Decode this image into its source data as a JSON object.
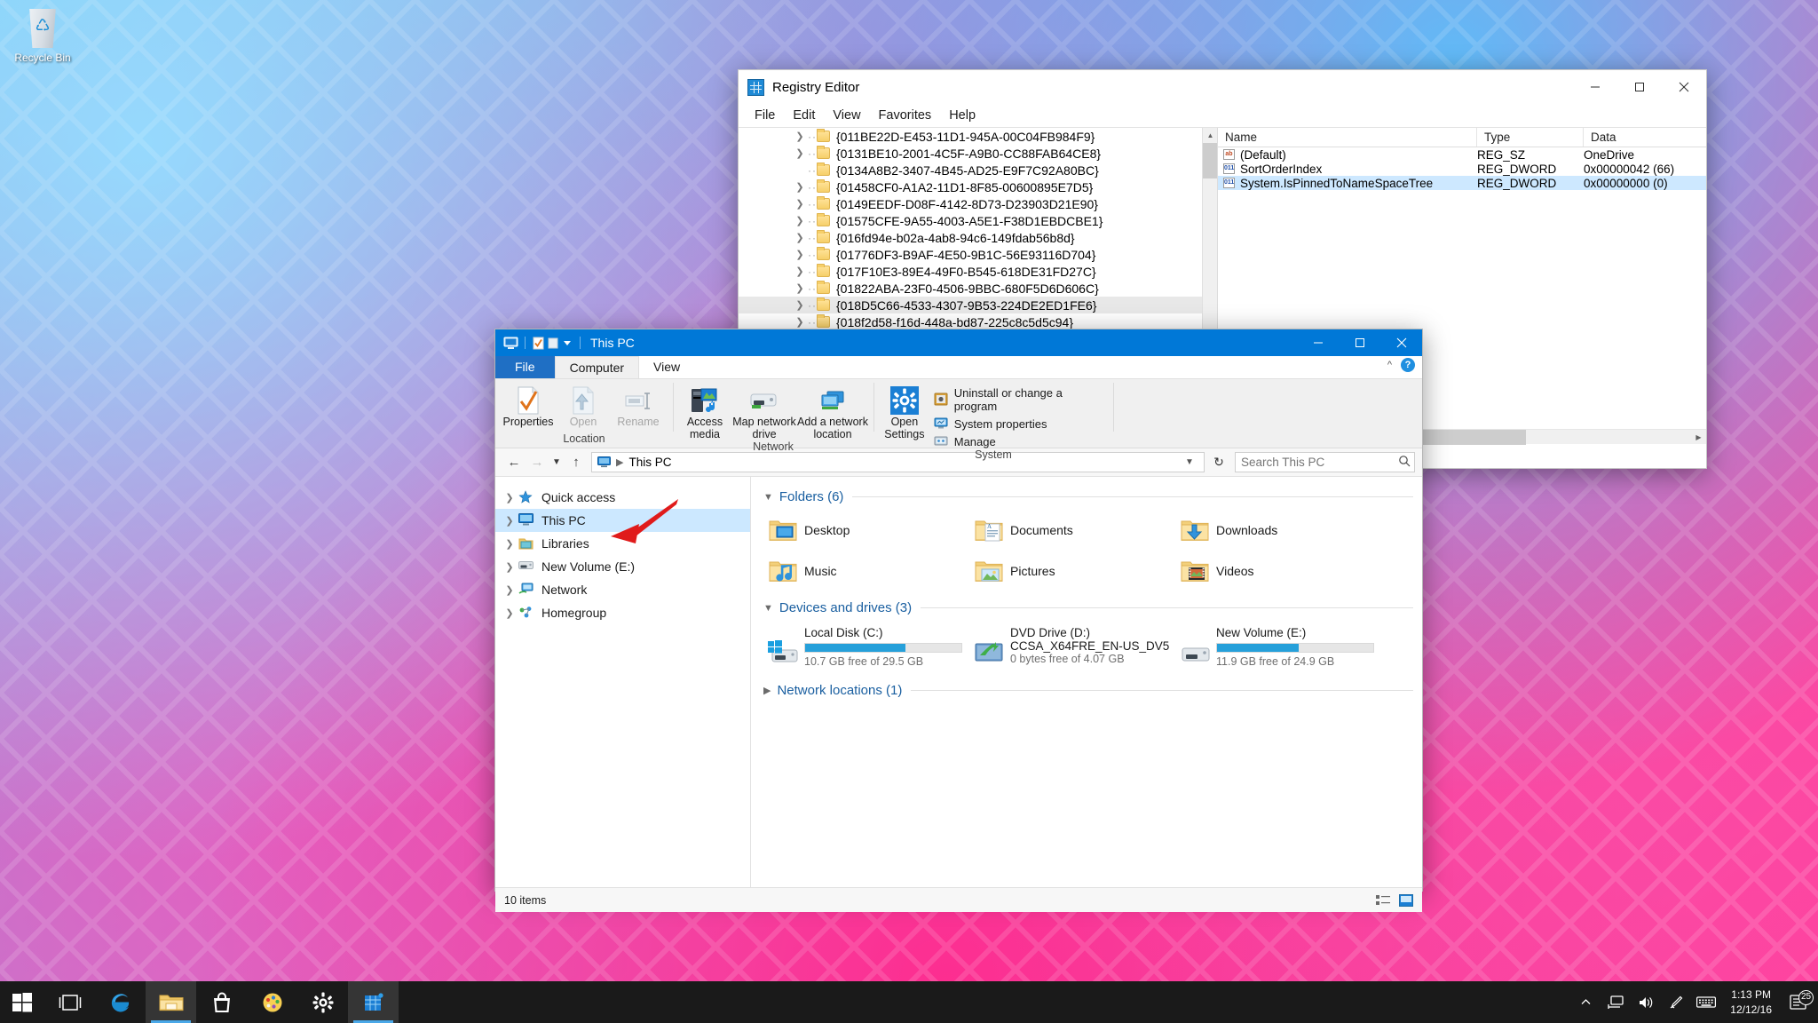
{
  "desktop": {
    "recycle_bin_label": "Recycle Bin"
  },
  "regedit": {
    "title": "Registry Editor",
    "menus": [
      "File",
      "Edit",
      "View",
      "Favorites",
      "Help"
    ],
    "window_buttons": [
      "minimize",
      "maximize",
      "close"
    ],
    "tree_items": [
      {
        "label": "{011BE22D-E453-11D1-945A-00C04FB984F9}",
        "expandable": true,
        "selected": false
      },
      {
        "label": "{0131BE10-2001-4C5F-A9B0-CC88FAB64CE8}",
        "expandable": true,
        "selected": false
      },
      {
        "label": "{0134A8B2-3407-4B45-AD25-E9F7C92A80BC}",
        "expandable": false,
        "selected": false
      },
      {
        "label": "{01458CF0-A1A2-11D1-8F85-00600895E7D5}",
        "expandable": true,
        "selected": false
      },
      {
        "label": "{0149EEDF-D08F-4142-8D73-D23903D21E90}",
        "expandable": true,
        "selected": false
      },
      {
        "label": "{01575CFE-9A55-4003-A5E1-F38D1EBDCBE1}",
        "expandable": true,
        "selected": false
      },
      {
        "label": "{016fd94e-b02a-4ab8-94c6-149fdab56b8d}",
        "expandable": true,
        "selected": false
      },
      {
        "label": "{01776DF3-B9AF-4E50-9B1C-56E93116D704}",
        "expandable": true,
        "selected": false
      },
      {
        "label": "{017F10E3-89E4-49F0-B545-618DE31FD27C}",
        "expandable": true,
        "selected": false
      },
      {
        "label": "{01822ABA-23F0-4506-9BBC-680F5D6D606C}",
        "expandable": true,
        "selected": false
      },
      {
        "label": "{018D5C66-4533-4307-9B53-224DE2ED1FE6}",
        "expandable": true,
        "selected": true
      },
      {
        "label": "{018f2d58-f16d-448a-bd87-225c8c5d5c94}",
        "expandable": true,
        "selected": false
      }
    ],
    "value_columns": [
      "Name",
      "Type",
      "Data"
    ],
    "values": [
      {
        "icon": "string-value-icon",
        "name": "(Default)",
        "type": "REG_SZ",
        "data": "OneDrive",
        "selected": false
      },
      {
        "icon": "dword-value-icon",
        "name": "SortOrderIndex",
        "type": "REG_DWORD",
        "data": "0x00000042 (66)",
        "selected": false
      },
      {
        "icon": "dword-value-icon",
        "name": "System.IsPinnedToNameSpaceTree",
        "type": "REG_DWORD",
        "data": "0x00000000 (0)",
        "selected": true
      }
    ]
  },
  "explorer": {
    "title": "This PC",
    "quick_access_toolbar": [
      "this-pc-icon",
      "properties-icon",
      "new-folder-icon",
      "customize-dropdown"
    ],
    "window_buttons": [
      "minimize",
      "maximize",
      "close"
    ],
    "ribbon_tabs": [
      {
        "label": "File",
        "state": "file"
      },
      {
        "label": "Computer",
        "state": "active"
      },
      {
        "label": "View",
        "state": "normal"
      }
    ],
    "ribbon_right": [
      "collapse-ribbon-chevron",
      "help-button"
    ],
    "ribbon_groups": [
      {
        "label": "Location",
        "buttons": [
          {
            "label": "Properties",
            "icon": "properties-icon",
            "disabled": false,
            "dropdown": false
          },
          {
            "label": "Open",
            "icon": "open-icon",
            "disabled": true,
            "dropdown": false
          },
          {
            "label": "Rename",
            "icon": "rename-icon",
            "disabled": true,
            "dropdown": false
          }
        ]
      },
      {
        "label": "Network",
        "buttons": [
          {
            "label": "Access media",
            "icon": "access-media-icon",
            "disabled": false,
            "dropdown": true
          },
          {
            "label": "Map network drive",
            "icon": "map-network-drive-icon",
            "disabled": false,
            "dropdown": true
          },
          {
            "label": "Add a network location",
            "icon": "add-network-location-icon",
            "disabled": false,
            "dropdown": false
          }
        ]
      },
      {
        "label": "System",
        "buttons": [
          {
            "label": "Open Settings",
            "icon": "open-settings-icon",
            "disabled": false,
            "dropdown": false
          }
        ],
        "small_commands": [
          {
            "label": "Uninstall or change a program",
            "icon": "uninstall-program-icon"
          },
          {
            "label": "System properties",
            "icon": "system-properties-icon"
          },
          {
            "label": "Manage",
            "icon": "manage-icon"
          }
        ]
      }
    ],
    "address_bar": {
      "back": "back-arrow",
      "forward": "forward-arrow",
      "recent": "recent-locations-chevron",
      "up": "up-arrow",
      "breadcrumb": [
        "This PC"
      ],
      "refresh": "refresh-icon"
    },
    "search": {
      "placeholder": "Search This PC",
      "value": ""
    },
    "nav_pane": [
      {
        "label": "Quick access",
        "icon": "star-icon",
        "selected": false
      },
      {
        "label": "This PC",
        "icon": "this-pc-icon",
        "selected": true
      },
      {
        "label": "Libraries",
        "icon": "libraries-icon",
        "selected": false
      },
      {
        "label": "New Volume (E:)",
        "icon": "drive-icon",
        "selected": false
      },
      {
        "label": "Network",
        "icon": "network-icon",
        "selected": false
      },
      {
        "label": "Homegroup",
        "icon": "homegroup-icon",
        "selected": false
      }
    ],
    "sections": {
      "folders": {
        "title": "Folders (6)",
        "expanded": true,
        "items": [
          {
            "label": "Desktop",
            "icon": "desktop-folder-icon"
          },
          {
            "label": "Documents",
            "icon": "documents-folder-icon"
          },
          {
            "label": "Downloads",
            "icon": "downloads-folder-icon"
          },
          {
            "label": "Music",
            "icon": "music-folder-icon"
          },
          {
            "label": "Pictures",
            "icon": "pictures-folder-icon"
          },
          {
            "label": "Videos",
            "icon": "videos-folder-icon"
          }
        ]
      },
      "devices": {
        "title": "Devices and drives (3)",
        "expanded": true,
        "items": [
          {
            "name": "Local Disk (C:)",
            "free": "10.7 GB free of 29.5 GB",
            "used_percent": 64,
            "icon": "windows-drive-icon",
            "subtitle": ""
          },
          {
            "name": "DVD Drive (D:)",
            "free": "0 bytes free of 4.07 GB",
            "used_percent": 100,
            "icon": "dvd-drive-icon",
            "subtitle": "CCSA_X64FRE_EN-US_DV5",
            "no_bar": true
          },
          {
            "name": "New Volume (E:)",
            "free": "11.9 GB free of 24.9 GB",
            "used_percent": 52,
            "icon": "drive-icon",
            "subtitle": ""
          }
        ]
      },
      "network": {
        "title": "Network locations (1)",
        "expanded": false
      }
    },
    "status": {
      "item_count": "10 items",
      "view_buttons": [
        "details-view-icon",
        "large-icons-view-icon"
      ]
    }
  },
  "taskbar": {
    "buttons": [
      {
        "name": "start-button",
        "icon": "windows-logo-icon",
        "active": false
      },
      {
        "name": "task-view-button",
        "icon": "task-view-icon",
        "active": false
      },
      {
        "name": "edge-button",
        "icon": "edge-icon",
        "active": false
      },
      {
        "name": "file-explorer-button",
        "icon": "folder-icon",
        "active": true
      },
      {
        "name": "store-button",
        "icon": "store-bag-icon",
        "active": false
      },
      {
        "name": "paint-button",
        "icon": "paint-palette-icon",
        "active": false
      },
      {
        "name": "settings-button",
        "icon": "gear-icon",
        "active": false
      },
      {
        "name": "registry-editor-button",
        "icon": "regedit-icon",
        "active": true
      }
    ],
    "tray": [
      {
        "name": "show-hidden-icons",
        "icon": "chevron-up-icon"
      },
      {
        "name": "network-tray-icon",
        "icon": "network-icon"
      },
      {
        "name": "volume-tray-icon",
        "icon": "speaker-icon"
      },
      {
        "name": "pen-tray-icon",
        "icon": "pen-icon"
      },
      {
        "name": "touch-keyboard-icon",
        "icon": "keyboard-icon"
      }
    ],
    "clock": {
      "time": "1:13 PM",
      "date": "12/12/16"
    },
    "action_center": {
      "icon": "action-center-icon",
      "badge": "25"
    }
  },
  "annotation": {
    "arrow_color": "#e01b1b"
  }
}
